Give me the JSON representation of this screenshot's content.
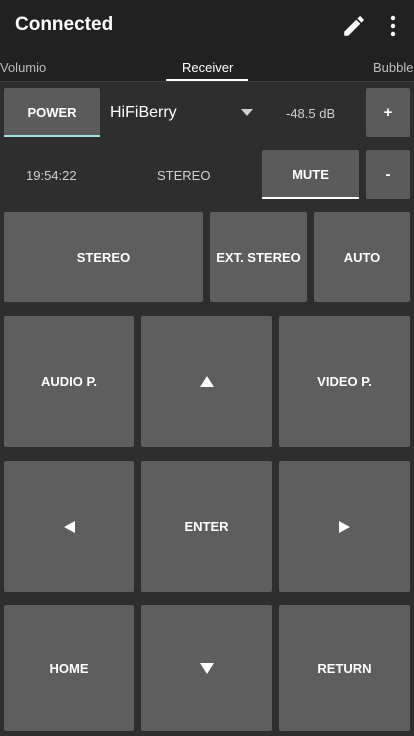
{
  "appbar": {
    "title": "Connected",
    "edit_icon": "pencil-icon",
    "menu_icon": "more-vert-icon"
  },
  "tabs": [
    {
      "label": "Volumio",
      "active": false
    },
    {
      "label": "Receiver",
      "active": true
    },
    {
      "label": "Bubble",
      "active": false
    }
  ],
  "receiver": {
    "power_label": "POWER",
    "source_value": "HiFiBerry",
    "volume": "-48.5 dB",
    "plus_label": "+",
    "minus_label": "-",
    "time": "19:54:22",
    "mode_status": "STEREO",
    "mute_label": "MUTE"
  },
  "sound_modes": {
    "stereo": "STEREO",
    "ext_stereo": "EXT. STEREO",
    "auto": "AUTO"
  },
  "pad": {
    "audio_p": "AUDIO P.",
    "video_p": "VIDEO P.",
    "enter": "ENTER",
    "home": "HOME",
    "return": "RETURN",
    "up_icon": "triangle-up-icon",
    "down_icon": "triangle-down-icon",
    "left_icon": "triangle-left-icon",
    "right_icon": "triangle-right-icon"
  },
  "colors": {
    "background": "#2e2e2e",
    "appbar": "#212121",
    "button": "#5b5b5b",
    "accent": "#9ee3e0"
  }
}
